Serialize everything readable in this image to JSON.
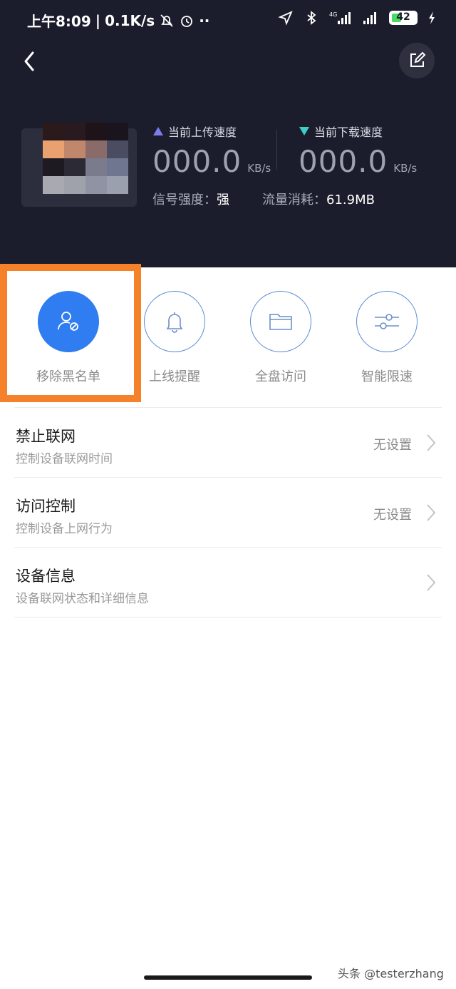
{
  "status_bar": {
    "time": "上午8:09",
    "net_speed": "0.1K/s",
    "network": "4G",
    "battery": "42",
    "battery_level_percent": 42
  },
  "header": {
    "bg_color": "#1c1d2c",
    "upload": {
      "label": "当前上传速度",
      "value": "000.0",
      "unit": "KB/s",
      "arrow_color": "#7b7cf0"
    },
    "download": {
      "label": "当前下载速度",
      "value": "000.0",
      "unit": "KB/s",
      "arrow_color": "#3ccfc8"
    },
    "signal_label": "信号强度：",
    "signal_value": "强",
    "traffic_label": "流量消耗：",
    "traffic_value": "61.9MB"
  },
  "actions": [
    {
      "label": "移除黑名单",
      "icon": "user-block-icon",
      "active": true
    },
    {
      "label": "上线提醒",
      "icon": "bell-icon",
      "active": false
    },
    {
      "label": "全盘访问",
      "icon": "folder-icon",
      "active": false
    },
    {
      "label": "智能限速",
      "icon": "sliders-icon",
      "active": false
    }
  ],
  "accent_color": "#2f7df0",
  "highlight_color": "#f5822a",
  "list": [
    {
      "title": "禁止联网",
      "subtitle": "控制设备联网时间",
      "value": "无设置"
    },
    {
      "title": "访问控制",
      "subtitle": "控制设备上网行为",
      "value": "无设置"
    },
    {
      "title": "设备信息",
      "subtitle": "设备联网状态和详细信息",
      "value": ""
    }
  ],
  "watermark": "头条 @testerzhang"
}
